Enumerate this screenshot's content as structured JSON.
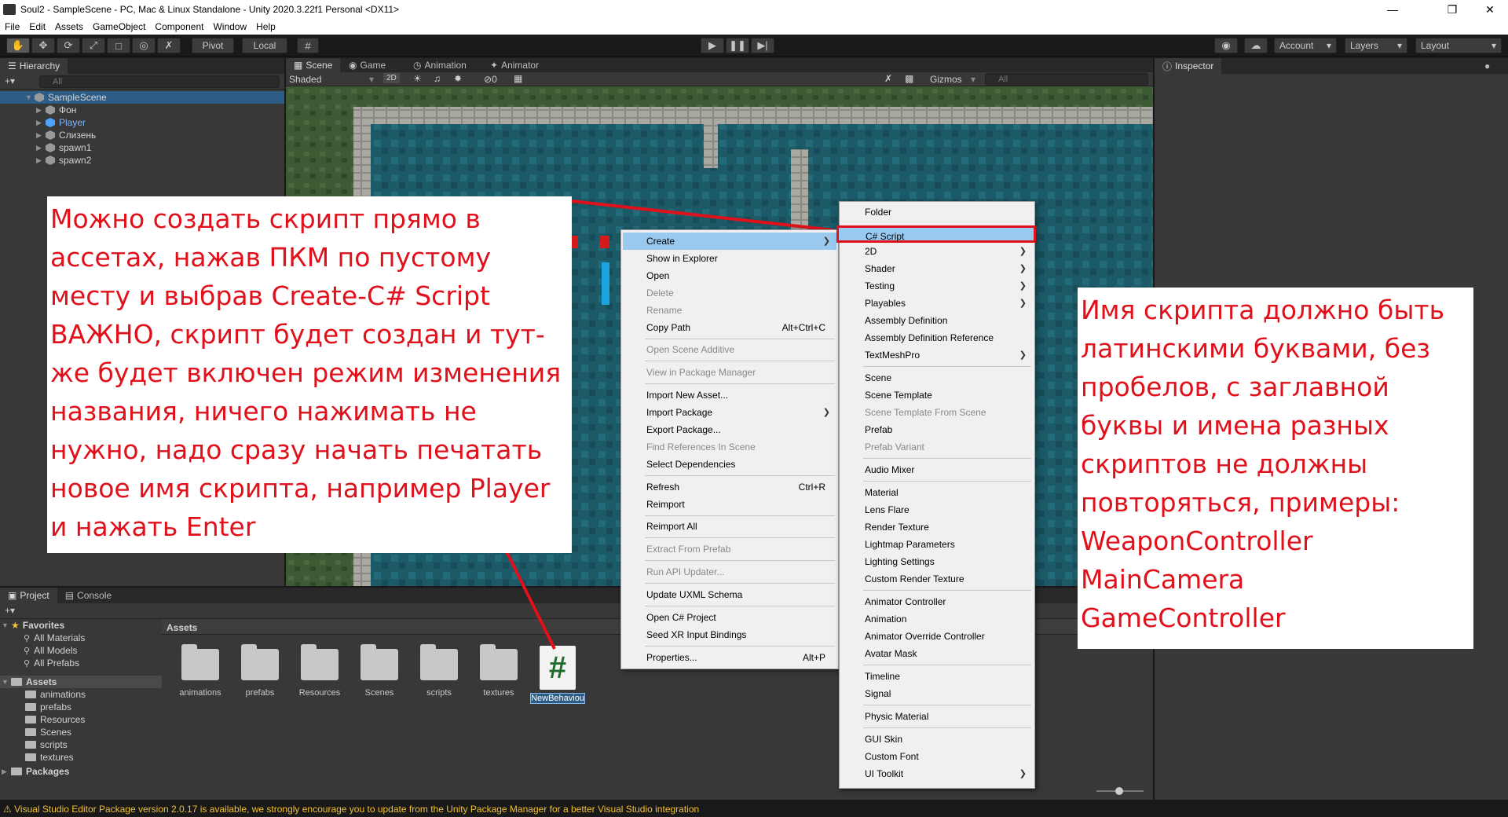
{
  "window": {
    "title": "Soul2 - SampleScene - PC, Mac & Linux Standalone - Unity 2020.3.22f1 Personal <DX11>"
  },
  "menubar": [
    "File",
    "Edit",
    "Assets",
    "GameObject",
    "Component",
    "Window",
    "Help"
  ],
  "toolbar": {
    "pivot": "Pivot",
    "local": "Local",
    "account": "Account",
    "layers": "Layers",
    "layout": "Layout"
  },
  "hierarchy": {
    "tab": "Hierarchy",
    "search_placeholder": "All",
    "scene": "SampleScene",
    "items": [
      "Фон",
      "Player",
      "Слизень",
      "spawn1",
      "spawn2"
    ]
  },
  "scene_tabs": [
    "Scene",
    "Game",
    "Animation",
    "Animator"
  ],
  "scene_toolbar": {
    "shading": "Shaded",
    "mode2d": "2D",
    "audio_count": "0",
    "gizmos": "Gizmos",
    "search_placeholder": "All"
  },
  "inspector": {
    "tab": "Inspector"
  },
  "project": {
    "tabs": [
      "Project",
      "Console"
    ],
    "favorites_label": "Favorites",
    "favorites": [
      "All Materials",
      "All Models",
      "All Prefabs"
    ],
    "assets_label": "Assets",
    "asset_folders": [
      "animations",
      "prefabs",
      "Resources",
      "Scenes",
      "scripts",
      "textures"
    ],
    "packages_label": "Packages",
    "breadcrumb": "Assets",
    "tiles": [
      "animations",
      "prefabs",
      "Resources",
      "Scenes",
      "scripts",
      "textures"
    ],
    "new_script": "NewBehaviou",
    "script_glyph": "#"
  },
  "context_menu": [
    {
      "label": "Create",
      "shortcut": "",
      "submenu": true,
      "disabled": false,
      "highlight": true
    },
    {
      "label": "Show in Explorer",
      "shortcut": "",
      "submenu": false,
      "disabled": false
    },
    {
      "label": "Open",
      "shortcut": "",
      "submenu": false,
      "disabled": false
    },
    {
      "label": "Delete",
      "shortcut": "",
      "submenu": false,
      "disabled": true
    },
    {
      "label": "Rename",
      "shortcut": "",
      "submenu": false,
      "disabled": true
    },
    {
      "label": "Copy Path",
      "shortcut": "Alt+Ctrl+C",
      "submenu": false,
      "disabled": false
    },
    {
      "label": "Open Scene Additive",
      "shortcut": "",
      "submenu": false,
      "disabled": true
    },
    {
      "label": "View in Package Manager",
      "shortcut": "",
      "submenu": false,
      "disabled": true
    },
    {
      "label": "Import New Asset...",
      "shortcut": "",
      "submenu": false,
      "disabled": false
    },
    {
      "label": "Import Package",
      "shortcut": "",
      "submenu": true,
      "disabled": false
    },
    {
      "label": "Export Package...",
      "shortcut": "",
      "submenu": false,
      "disabled": false
    },
    {
      "label": "Find References In Scene",
      "shortcut": "",
      "submenu": false,
      "disabled": true
    },
    {
      "label": "Select Dependencies",
      "shortcut": "",
      "submenu": false,
      "disabled": false
    },
    {
      "label": "Refresh",
      "shortcut": "Ctrl+R",
      "submenu": false,
      "disabled": false
    },
    {
      "label": "Reimport",
      "shortcut": "",
      "submenu": false,
      "disabled": false
    },
    {
      "label": "Reimport All",
      "shortcut": "",
      "submenu": false,
      "disabled": false
    },
    {
      "label": "Extract From Prefab",
      "shortcut": "",
      "submenu": false,
      "disabled": true
    },
    {
      "label": "Run API Updater...",
      "shortcut": "",
      "submenu": false,
      "disabled": true
    },
    {
      "label": "Update UXML Schema",
      "shortcut": "",
      "submenu": false,
      "disabled": false
    },
    {
      "label": "Open C# Project",
      "shortcut": "",
      "submenu": false,
      "disabled": false
    },
    {
      "label": "Seed XR Input Bindings",
      "shortcut": "",
      "submenu": false,
      "disabled": false
    },
    {
      "label": "Properties...",
      "shortcut": "Alt+P",
      "submenu": false,
      "disabled": false
    }
  ],
  "create_submenu": [
    {
      "label": "Folder",
      "submenu": false,
      "disabled": false
    },
    {
      "label": "C# Script",
      "submenu": false,
      "disabled": false,
      "highlight": true
    },
    {
      "label": "2D",
      "submenu": true,
      "disabled": false
    },
    {
      "label": "Shader",
      "submenu": true,
      "disabled": false
    },
    {
      "label": "Testing",
      "submenu": true,
      "disabled": false
    },
    {
      "label": "Playables",
      "submenu": true,
      "disabled": false
    },
    {
      "label": "Assembly Definition",
      "submenu": false,
      "disabled": false
    },
    {
      "label": "Assembly Definition Reference",
      "submenu": false,
      "disabled": false
    },
    {
      "label": "TextMeshPro",
      "submenu": true,
      "disabled": false
    },
    {
      "label": "Scene",
      "submenu": false,
      "disabled": false
    },
    {
      "label": "Scene Template",
      "submenu": false,
      "disabled": false
    },
    {
      "label": "Scene Template From Scene",
      "submenu": false,
      "disabled": true
    },
    {
      "label": "Prefab",
      "submenu": false,
      "disabled": false
    },
    {
      "label": "Prefab Variant",
      "submenu": false,
      "disabled": true
    },
    {
      "label": "Audio Mixer",
      "submenu": false,
      "disabled": false
    },
    {
      "label": "Material",
      "submenu": false,
      "disabled": false
    },
    {
      "label": "Lens Flare",
      "submenu": false,
      "disabled": false
    },
    {
      "label": "Render Texture",
      "submenu": false,
      "disabled": false
    },
    {
      "label": "Lightmap Parameters",
      "submenu": false,
      "disabled": false
    },
    {
      "label": "Lighting Settings",
      "submenu": false,
      "disabled": false
    },
    {
      "label": "Custom Render Texture",
      "submenu": false,
      "disabled": false
    },
    {
      "label": "Animator Controller",
      "submenu": false,
      "disabled": false
    },
    {
      "label": "Animation",
      "submenu": false,
      "disabled": false
    },
    {
      "label": "Animator Override Controller",
      "submenu": false,
      "disabled": false
    },
    {
      "label": "Avatar Mask",
      "submenu": false,
      "disabled": false
    },
    {
      "label": "Timeline",
      "submenu": false,
      "disabled": false
    },
    {
      "label": "Signal",
      "submenu": false,
      "disabled": false
    },
    {
      "label": "Physic Material",
      "submenu": false,
      "disabled": false
    },
    {
      "label": "GUI Skin",
      "submenu": false,
      "disabled": false
    },
    {
      "label": "Custom Font",
      "submenu": false,
      "disabled": false
    },
    {
      "label": "UI Toolkit",
      "submenu": true,
      "disabled": false
    }
  ],
  "annotation_left": "Можно создать скрипт прямо в ассетах, нажав ПКМ по пустому месту и выбрав Create-C# Script\nВАЖНО, скрипт будет создан и тут-же будет включен режим изменения названия, ничего нажимать не нужно, надо сразу начать печатать новое имя скрипта, например Player и нажать Enter",
  "annotation_right": "Имя скрипта должно быть латинскими буквами, без пробелов, с заглавной буквы и имена разных скриптов не должны повторяться, примеры:\nWeaponController\nMainCamera\nGameController",
  "status": "Visual Studio Editor Package version 2.0.17 is available, we strongly encourage you to update from the Unity Package Manager for a better Visual Studio integration",
  "colors": {
    "annotation": "#e0111b",
    "highlight": "#99c9ef",
    "selection": "#2c5d87"
  }
}
